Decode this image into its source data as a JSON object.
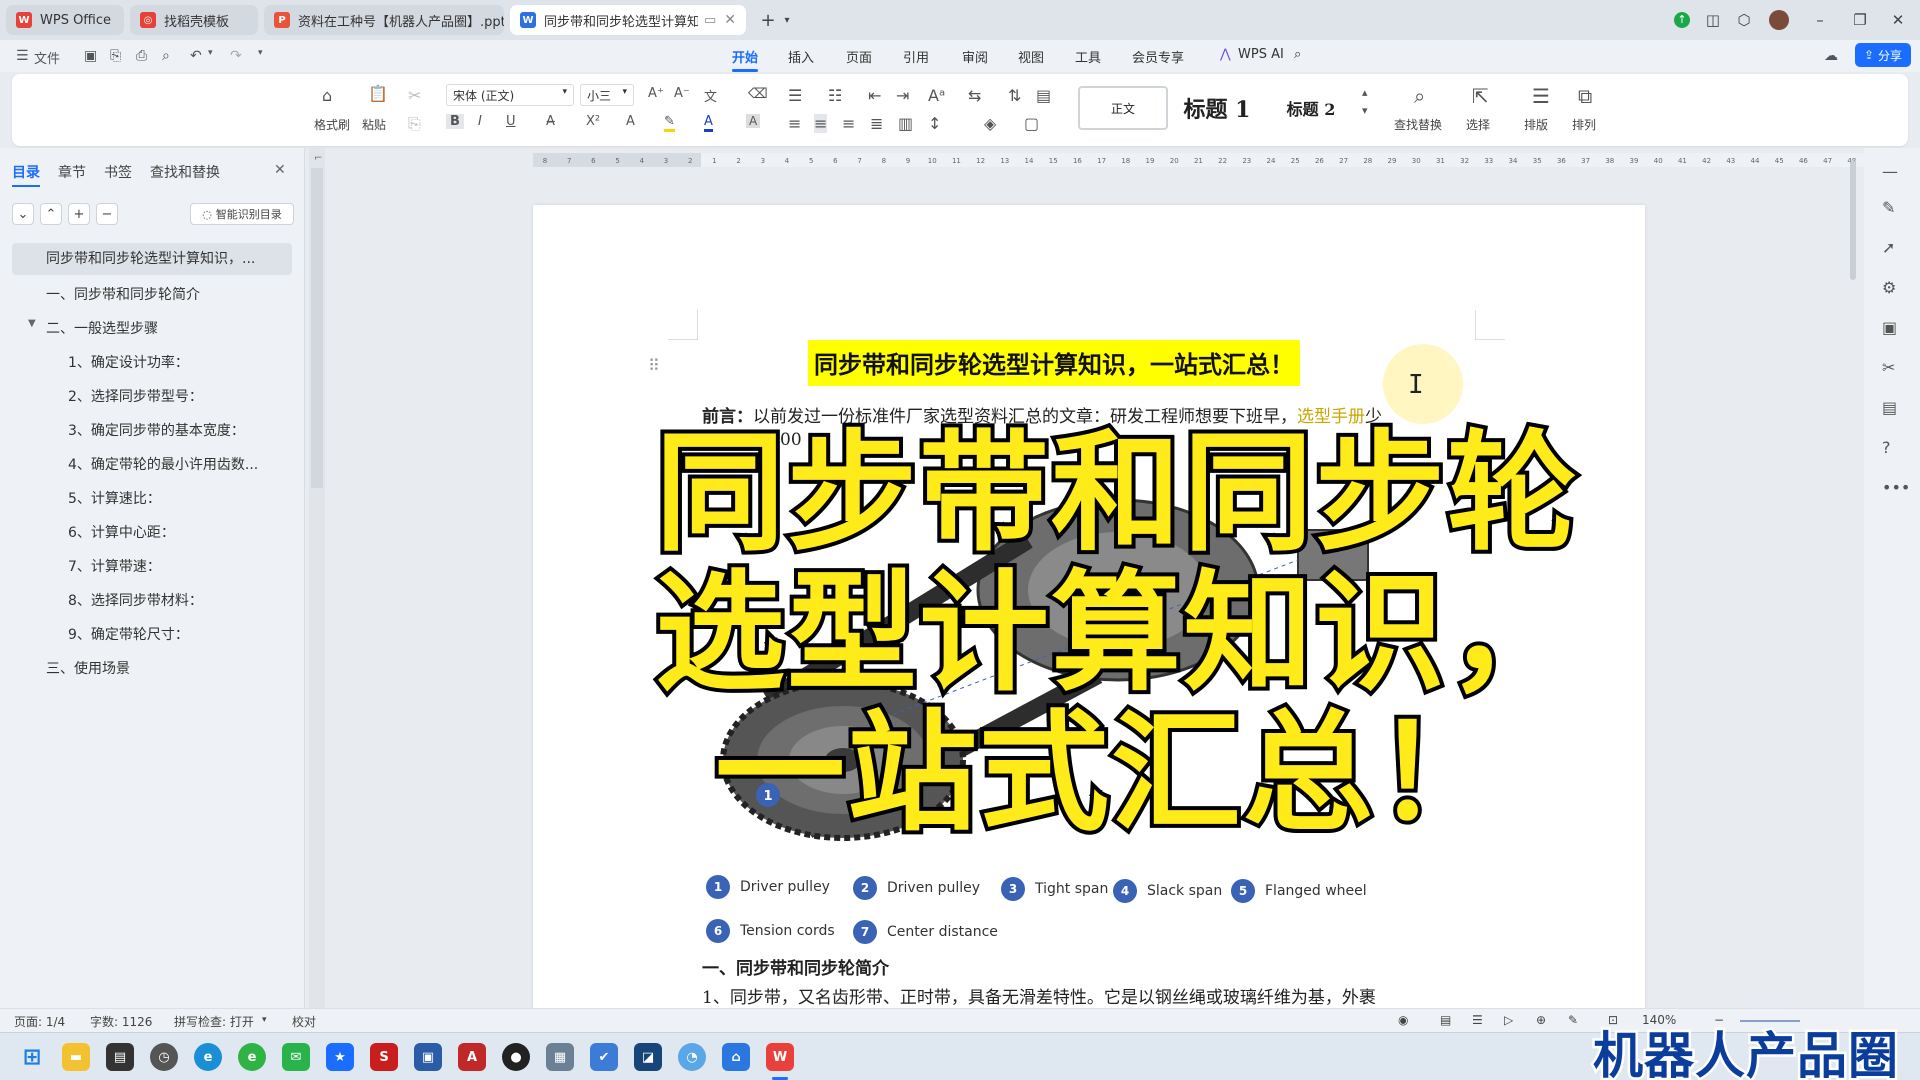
{
  "tabs": [
    {
      "label": "WPS Office",
      "icon": "W",
      "color": "#e8403a",
      "active": false
    },
    {
      "label": "找稻壳模板",
      "icon": "◎",
      "color": "#e8403a",
      "active": false
    },
    {
      "label": "资料在工种号【机器人产品圈】.pptx",
      "icon": "P",
      "color": "#e8543a",
      "active": false
    },
    {
      "label": "同步带和同步轮选型计算知识,",
      "icon": "W",
      "color": "#2f6fe4",
      "active": true
    }
  ],
  "menu": {
    "file": "文件",
    "items": [
      "开始",
      "插入",
      "页面",
      "引用",
      "审阅",
      "视图",
      "工具",
      "会员专享",
      "WPS AI"
    ],
    "active": "开始",
    "share": "分享"
  },
  "ribbon": {
    "format_painter": "格式刷",
    "paste": "粘贴",
    "font_name": "宋体 (正文)",
    "font_size": "小三",
    "style_normal": "正文",
    "style_h1": "标题 1",
    "style_h2": "标题 2",
    "find_replace": "查找替换",
    "select": "选择",
    "layout": "排版",
    "arrange": "排列"
  },
  "sidebar": {
    "tabs": [
      "目录",
      "章节",
      "书签",
      "查找和替换"
    ],
    "active_tab": "目录",
    "smart_toc": "智能识别目录",
    "toc": [
      {
        "label": "同步带和同步轮选型计算知识，...",
        "level": 0,
        "selected": true
      },
      {
        "label": "一、同步带和同步轮简介",
        "level": 1
      },
      {
        "label": "二、一般选型步骤",
        "level": 1,
        "expanded": true
      },
      {
        "label": "1、确定设计功率：",
        "level": 2
      },
      {
        "label": "2、选择同步带型号：",
        "level": 2
      },
      {
        "label": "3、确定同步带的基本宽度：",
        "level": 2
      },
      {
        "label": "4、确定带轮的最小许用齿数...",
        "level": 2
      },
      {
        "label": "5、计算速比：",
        "level": 2
      },
      {
        "label": "6、计算中心距：",
        "level": 2
      },
      {
        "label": "7、计算带速：",
        "level": 2
      },
      {
        "label": "8、选择同步带材料：",
        "level": 2
      },
      {
        "label": "9、确定带轮尺寸：",
        "level": 2
      },
      {
        "label": "三、使用场景",
        "level": 1
      }
    ]
  },
  "document": {
    "title": "同步带和同步轮选型计算知识，一站式汇总！",
    "preface_label": "前言：",
    "preface_text": "以前发过一份标准件厂家选型资料汇总的文章：研发工程师想要下班早，",
    "preface_link": "选型手册",
    "preface_tail": "少",
    "preface_line2_start": "00",
    "legend": [
      {
        "num": "1",
        "label": "Driver pulley"
      },
      {
        "num": "2",
        "label": "Driven pulley"
      },
      {
        "num": "3",
        "label": "Tight span"
      },
      {
        "num": "4",
        "label": "Slack span"
      },
      {
        "num": "5",
        "label": "Flanged wheel"
      },
      {
        "num": "6",
        "label": "Tension cords"
      },
      {
        "num": "7",
        "label": "Center distance"
      }
    ],
    "diagram_marker": "1",
    "section1": "一、同步带和同步轮简介",
    "para1": "1、同步带，又名齿形带、正时带，具备无滑差特性。它是以钢丝绳或玻璃纤维为基，外裹"
  },
  "overlay": {
    "line1": "同步带和同步轮",
    "line2": "选型计算知识，",
    "line3": "一站式汇总！",
    "fill_color": "#ffeb1a"
  },
  "status": {
    "page": "页面: 1/4",
    "words": "字数: 1126",
    "spell": "拼写检查: 打开",
    "proof": "校对",
    "zoom": "140%"
  },
  "watermark": "机器人产品圈"
}
